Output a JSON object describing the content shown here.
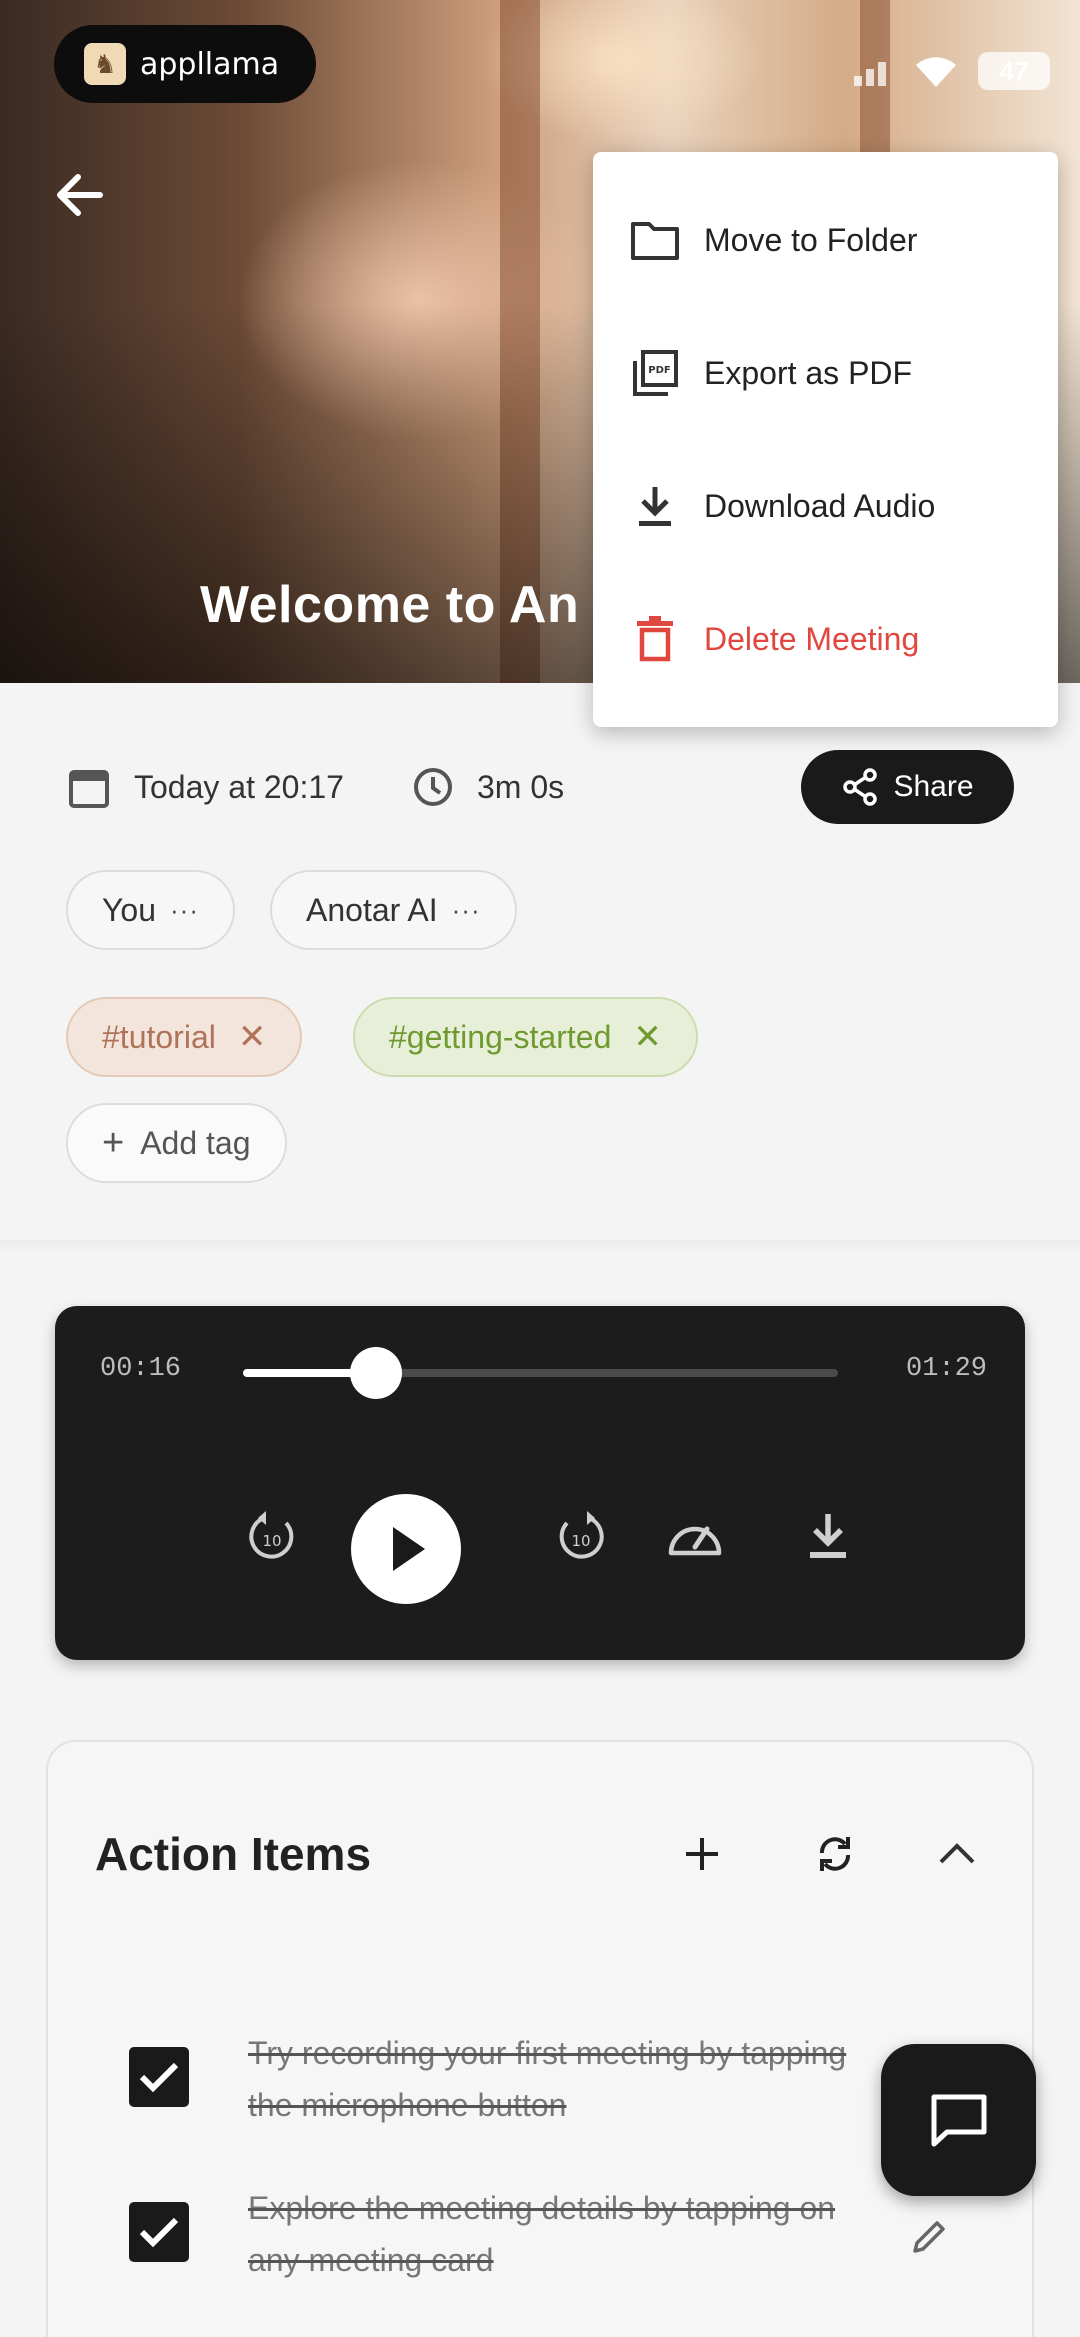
{
  "app": {
    "brand": "appllama"
  },
  "status_bar": {
    "battery": "47"
  },
  "hero": {
    "title": "Welcome to An"
  },
  "menu": {
    "items": [
      {
        "label": "Move to Folder",
        "icon": "folder-icon"
      },
      {
        "label": "Export as PDF",
        "icon": "pdf-icon"
      },
      {
        "label": "Download Audio",
        "icon": "download-icon"
      },
      {
        "label": "Delete Meeting",
        "icon": "trash-icon",
        "color": "#e0473e"
      }
    ]
  },
  "meta": {
    "date": "Today at 20:17",
    "duration": "3m 0s",
    "share_label": "Share"
  },
  "participants": [
    {
      "name": "You",
      "more": "···"
    },
    {
      "name": "Anotar AI",
      "more": "···"
    }
  ],
  "tags": [
    {
      "label": "#tutorial",
      "remove": "✕",
      "color": "#b0735a"
    },
    {
      "label": "#getting-started",
      "remove": "✕",
      "color": "#6f9a2f"
    }
  ],
  "add_tag": {
    "plus": "+",
    "label": "Add tag"
  },
  "player": {
    "current": "00:16",
    "total": "01:29",
    "progress": 0.18,
    "skip_seconds": "10"
  },
  "action_items": {
    "title": "Action Items",
    "items": [
      {
        "text": "Try recording your first meeting by tapping the microphone button",
        "done": true
      },
      {
        "text": "Explore the meeting details by tapping on any meeting card",
        "done": true
      }
    ]
  }
}
